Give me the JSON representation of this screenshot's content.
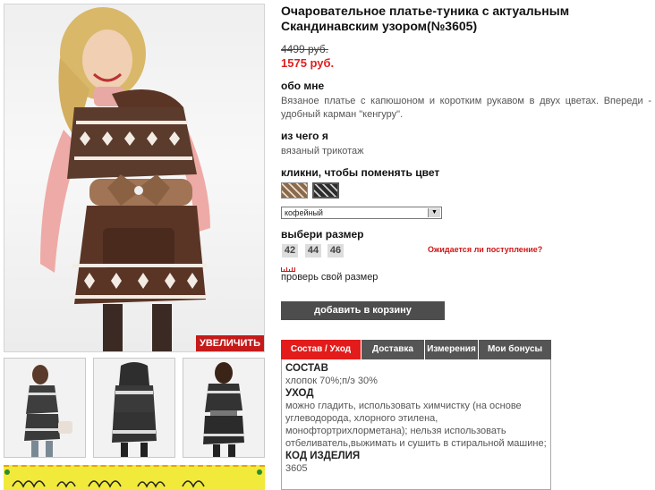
{
  "product": {
    "title": "Очаровательное платье-туника с актуальным Скандинавским узором(№3605)",
    "old_price": "4499 руб.",
    "new_price": "1575 руб."
  },
  "gallery": {
    "zoom_label": "УВЕЛИЧИТЬ",
    "thumbnails": [
      "front-view",
      "back-view",
      "side-view"
    ]
  },
  "about": {
    "heading": "обо мне",
    "text": "Вязаное платье с капюшоном и коротким рукавом в двух цветах. Впереди - удобный карман \"кенгуру\"."
  },
  "material": {
    "heading": "из чего я",
    "text": "вязаный трикотаж"
  },
  "color": {
    "heading": "кликни, чтобы поменять цвет",
    "swatches": [
      {
        "name": "coffee",
        "color": "#8a6a4a"
      },
      {
        "name": "black",
        "color": "#2c2c2c"
      }
    ],
    "selected": "кофейный"
  },
  "size": {
    "heading": "выбери размер",
    "options": [
      "42",
      "44",
      "46"
    ],
    "await_link": "Ожидается ли поступление?",
    "check_link": "проверь свой размер"
  },
  "cart": {
    "button_label": "добавить в корзину"
  },
  "tabs": {
    "items": [
      "Состав / Уход",
      "Доставка",
      "Измерения",
      "Мои бонусы"
    ],
    "active": 0,
    "content": {
      "composition_heading": "СОСТАВ",
      "composition_text": "хлопок 70%;п/э 30%",
      "care_heading": "УХОД",
      "care_text": "можно гладить, использовать химчистку (на основе углеводорода, хлорного этилена, монофтортрихлорметана); нельзя использовать отбеливатель,выжимать и сушить в стиральной машине;",
      "code_heading": "КОД ИЗДЕЛИЯ",
      "code_value": "3605"
    }
  },
  "colors": {
    "accent_red": "#e31b1b",
    "price_red": "#e02020",
    "dark_button": "#4d4d4d",
    "banner_yellow": "#f1ea3b"
  }
}
